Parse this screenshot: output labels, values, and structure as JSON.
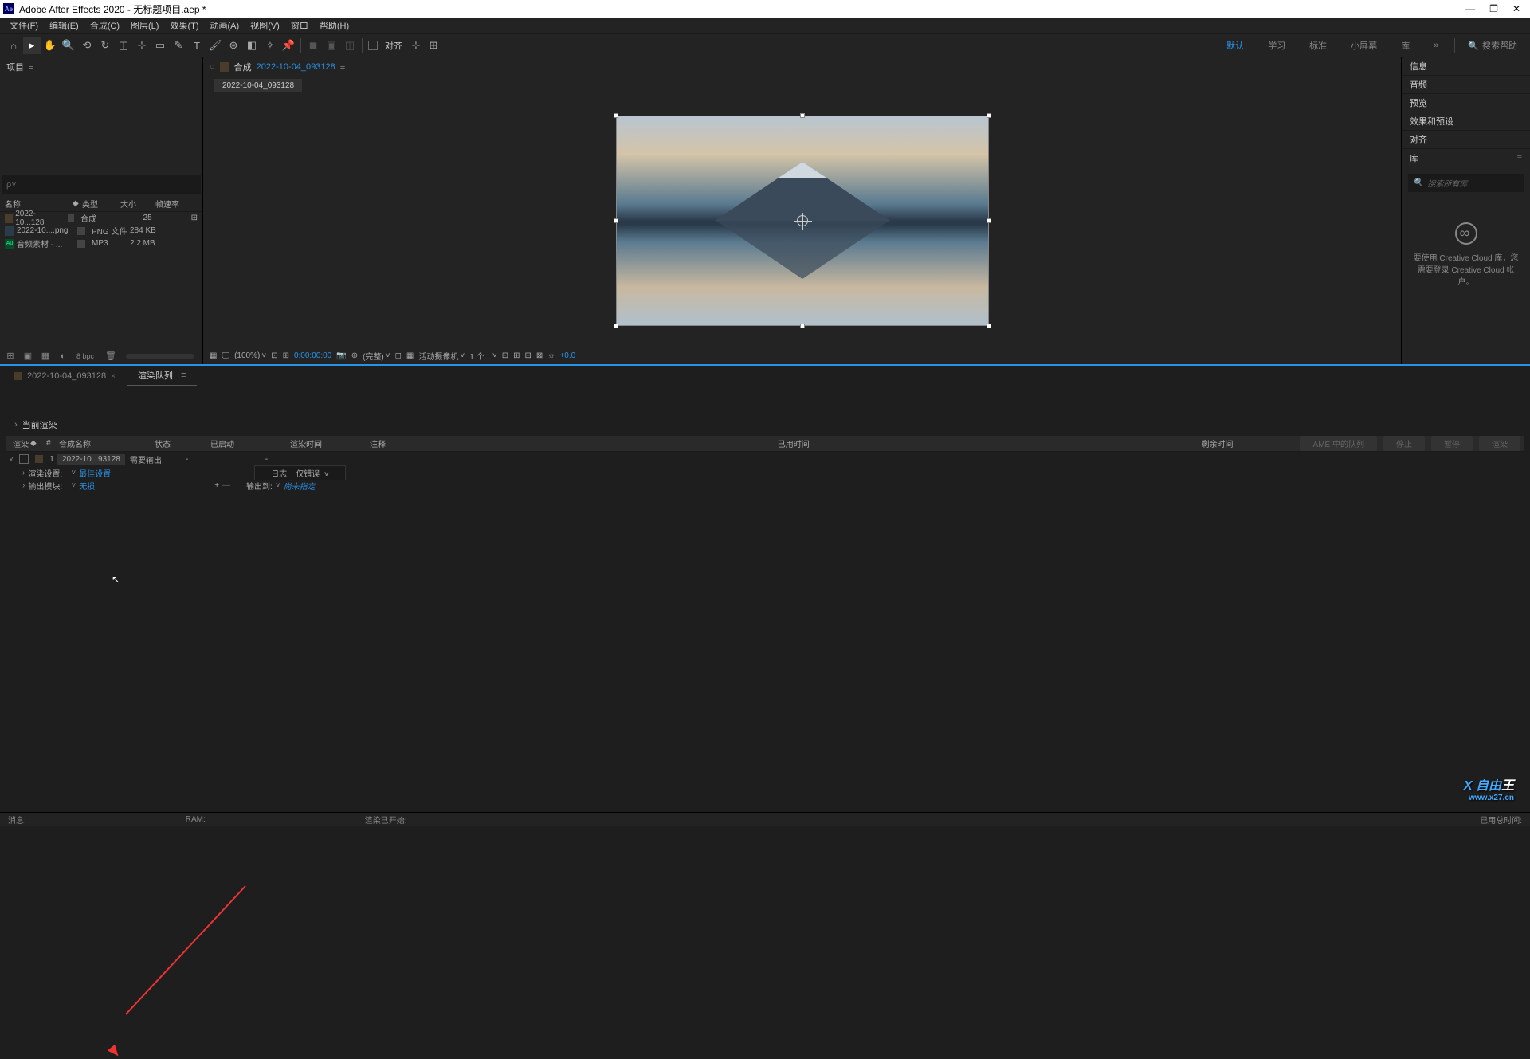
{
  "window": {
    "app": "Adobe After Effects 2020",
    "project": "无标题项目.aep *"
  },
  "window_controls": {
    "min": "—",
    "max": "❐",
    "close": "✕"
  },
  "menu": {
    "file": "文件(F)",
    "edit": "编辑(E)",
    "comp": "合成(C)",
    "layer": "图层(L)",
    "effect": "效果(T)",
    "anim": "动画(A)",
    "view": "视图(V)",
    "window": "窗口",
    "help": "帮助(H)"
  },
  "toolbar": {
    "align_label": "对齐"
  },
  "workspaces": {
    "default": "默认",
    "learn": "学习",
    "standard": "标准",
    "small": "小屏幕",
    "lib": "库",
    "more": "»"
  },
  "search_help": {
    "placeholder": "搜索帮助"
  },
  "panels": {
    "project": "项目",
    "info": "信息",
    "audio": "音频",
    "effects": "预览",
    "ep": "效果和预设",
    "align": "对齐",
    "library": "库"
  },
  "project_search": "ρ˅",
  "project_headers": {
    "name": "名称",
    "tag": "◆",
    "type": "类型",
    "size": "大小",
    "fps": "帧速率"
  },
  "project_items": [
    {
      "name": "2022-10...128",
      "type": "合成",
      "size": "",
      "fps": "25"
    },
    {
      "name": "2022-10....png",
      "type": "PNG 文件",
      "size": "284 KB",
      "fps": ""
    },
    {
      "name": "音频素材 - ...",
      "type": "MP3",
      "size": "2.2 MB",
      "fps": ""
    }
  ],
  "project_footer": {
    "bpc": "8 bpc"
  },
  "viewer": {
    "label": "合成",
    "comp_name": "2022-10-04_093128",
    "subtab": "2022-10-04_093128"
  },
  "viewer_footer": {
    "zoom": "(100%)",
    "time": "0:00:00:00",
    "res": "(完整)",
    "camera": "活动摄像机",
    "view": "1 个...",
    "expo": "+0.0"
  },
  "right_cc": {
    "text": "要使用 Creative Cloud 库，您需要登录 Creative Cloud 帐户。"
  },
  "lib_search": "搜索所有库",
  "timeline": {
    "tab1": "2022-10-04_093128",
    "tab2": "渲染队列",
    "current": "当前渲染",
    "headers": {
      "render": "渲染",
      "tag": "◆",
      "num": "#",
      "name": "合成名称",
      "status": "状态",
      "start": "已启动",
      "rtime": "渲染时间",
      "notes": "注释",
      "elapsed": "已用时间",
      "remain": "剩余时间"
    },
    "buttons": {
      "ame": "AME 中的队列",
      "stop": "停止",
      "pause": "暂停",
      "render": "渲染"
    },
    "item": {
      "num": "1",
      "name": "2022-10...93128",
      "status": "需要输出",
      "dash": "-"
    },
    "render_settings": {
      "label": "渲染设置:",
      "value": "最佳设置",
      "log_label": "日志:",
      "log_value": "仅错误"
    },
    "output_module": {
      "label": "输出模块:",
      "value": "无损",
      "plus": "+",
      "minus": "—",
      "out_label": "输出到:",
      "out_value": "尚未指定"
    }
  },
  "statusbar": {
    "msg": "消息:",
    "ram": "RAM:",
    "started": "渲染已开始:",
    "total": "已用总时间:"
  },
  "watermark": {
    "brand": "X 自由",
    "suffix": "王",
    "url": "www.x27.cn"
  }
}
